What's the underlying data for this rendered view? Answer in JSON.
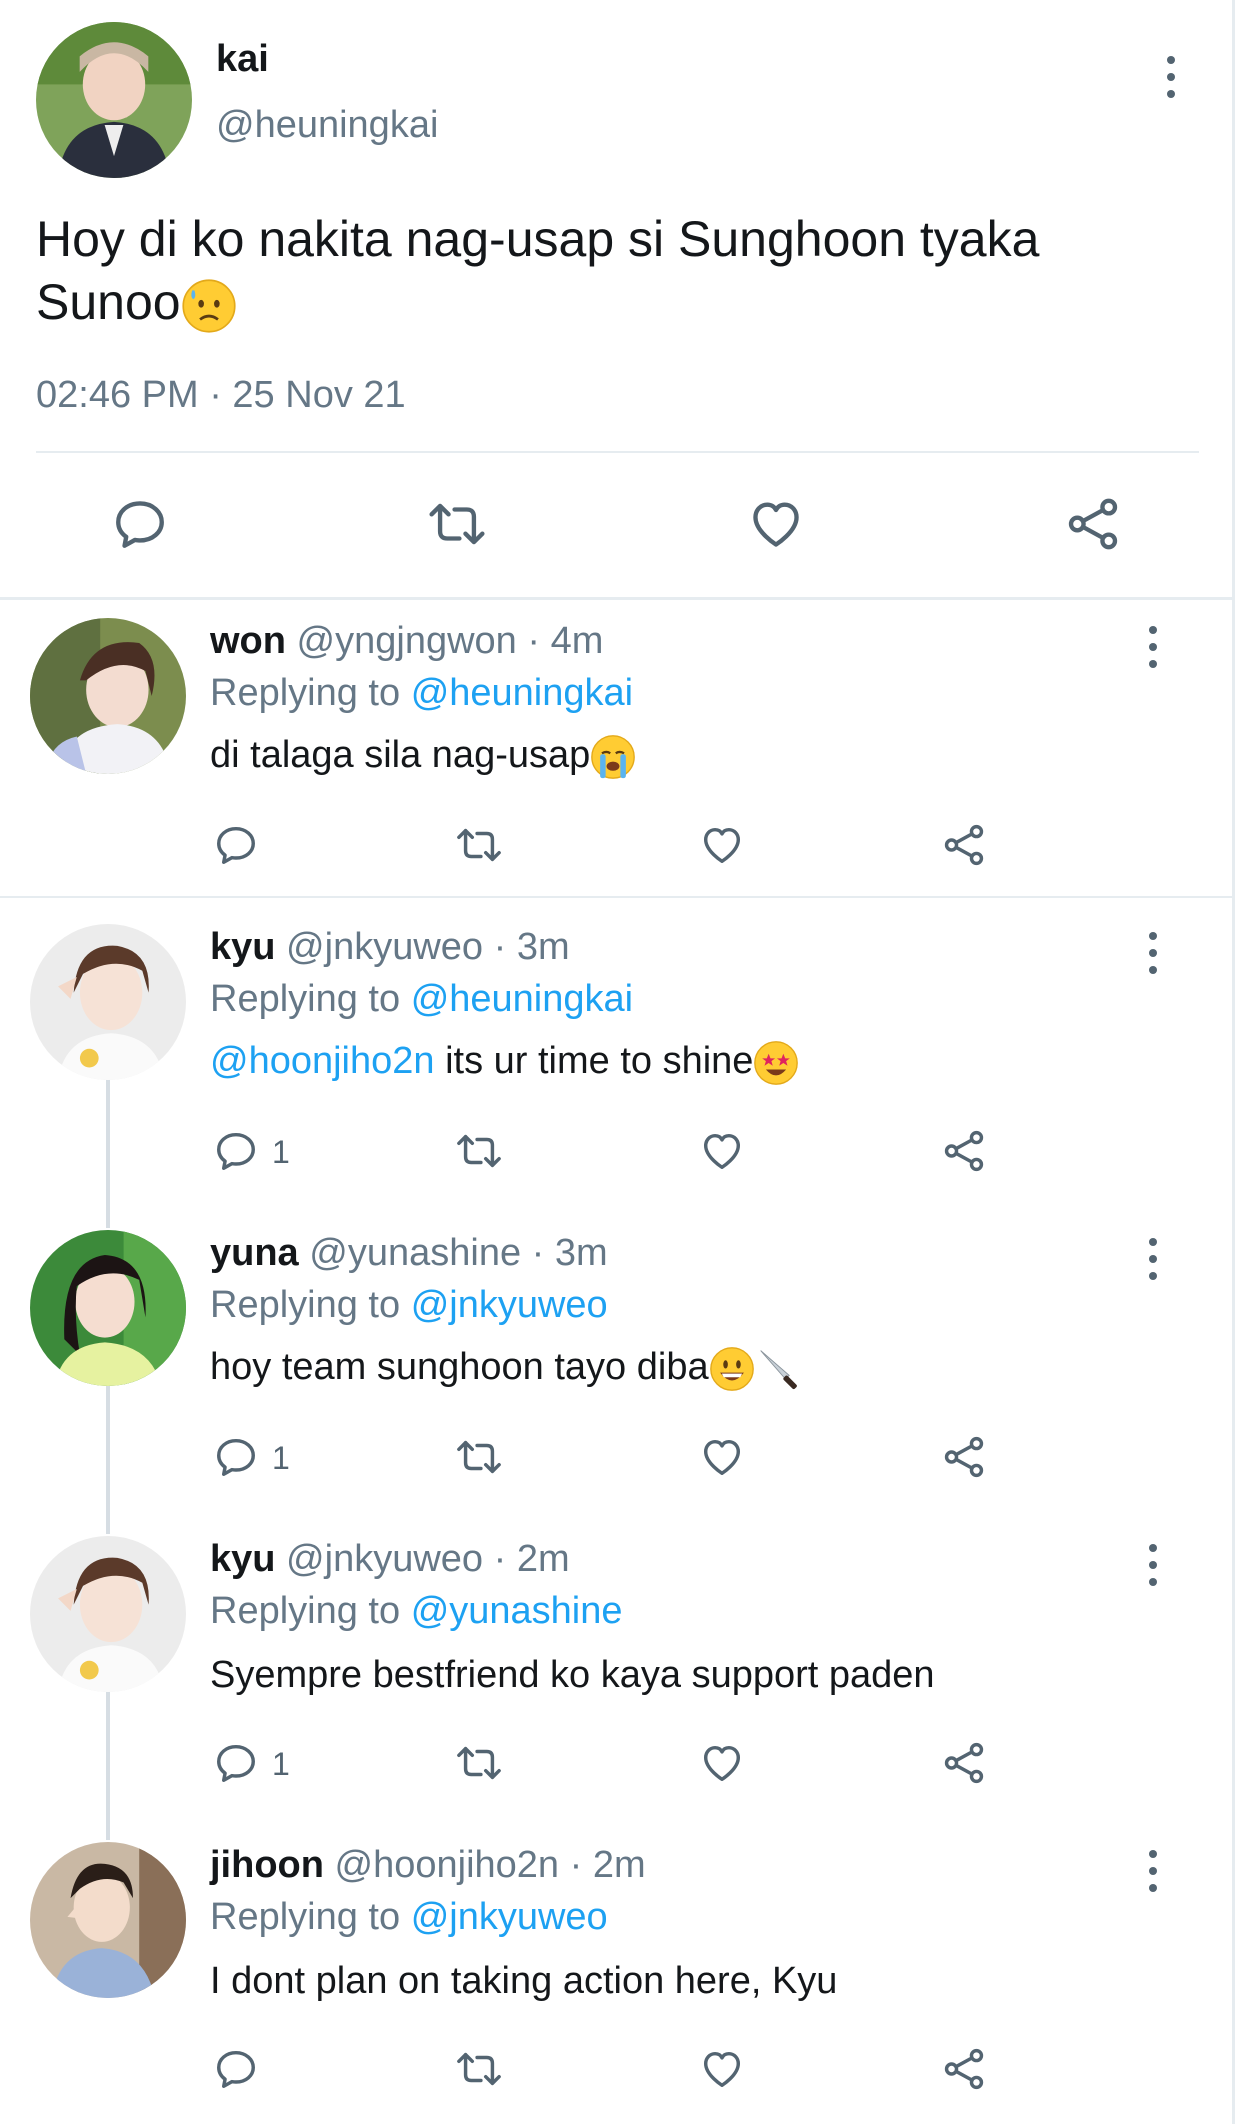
{
  "main_tweet": {
    "name": "kai",
    "handle": "@heuningkai",
    "text": "Hoy di ko nakita nag-usap si Sunghoon tyaka Sunoo",
    "text_line1": "Hoy di ko nakita nag-usap si Sunghoon tyaka",
    "text_line2": "Sunoo",
    "emoji": "worried-sweat-face-emoji",
    "timestamp": "02:46 PM · 25 Nov 21"
  },
  "actions": {
    "reply_icon": "reply-icon",
    "retweet_icon": "retweet-icon",
    "like_icon": "heart-icon",
    "share_icon": "share-icon"
  },
  "replies": [
    {
      "name": "won",
      "handle": "@yngjngwon",
      "time": "· 4m",
      "replying_label": "Replying to",
      "replying_to": "@heuningkai",
      "text": "di talaga sila nag-usap",
      "emoji": "loudly-crying-face-emoji",
      "reply_count": ""
    },
    {
      "name": "kyu",
      "handle": "@jnkyuweo",
      "time": "· 3m",
      "replying_label": "Replying to",
      "replying_to": "@heuningkai",
      "mention": "@hoonjiho2n",
      "text": " its ur time to shine",
      "emoji": "star-struck-face-emoji",
      "reply_count": "1"
    },
    {
      "name": "yuna",
      "handle": "@yunashine",
      "time": "· 3m",
      "replying_label": "Replying to",
      "replying_to": "@jnkyuweo",
      "text": "hoy team sunghoon tayo diba",
      "emoji": "grinning-face-emoji",
      "emoji2": "knife-emoji",
      "reply_count": "1"
    },
    {
      "name": "kyu",
      "handle": "@jnkyuweo",
      "time": "· 2m",
      "replying_label": "Replying to",
      "replying_to": "@yunashine",
      "text": "Syempre bestfriend ko kaya support paden",
      "reply_count": "1"
    },
    {
      "name": "jihoon",
      "handle": "@hoonjiho2n",
      "time": "· 2m",
      "replying_label": "Replying to",
      "replying_to": "@jnkyuweo",
      "text": "I dont plan on taking action here, Kyu",
      "reply_count": ""
    }
  ],
  "colors": {
    "link": "#1da1f2",
    "muted": "#657786",
    "text": "#14171a",
    "divider": "#e6ecf0"
  }
}
